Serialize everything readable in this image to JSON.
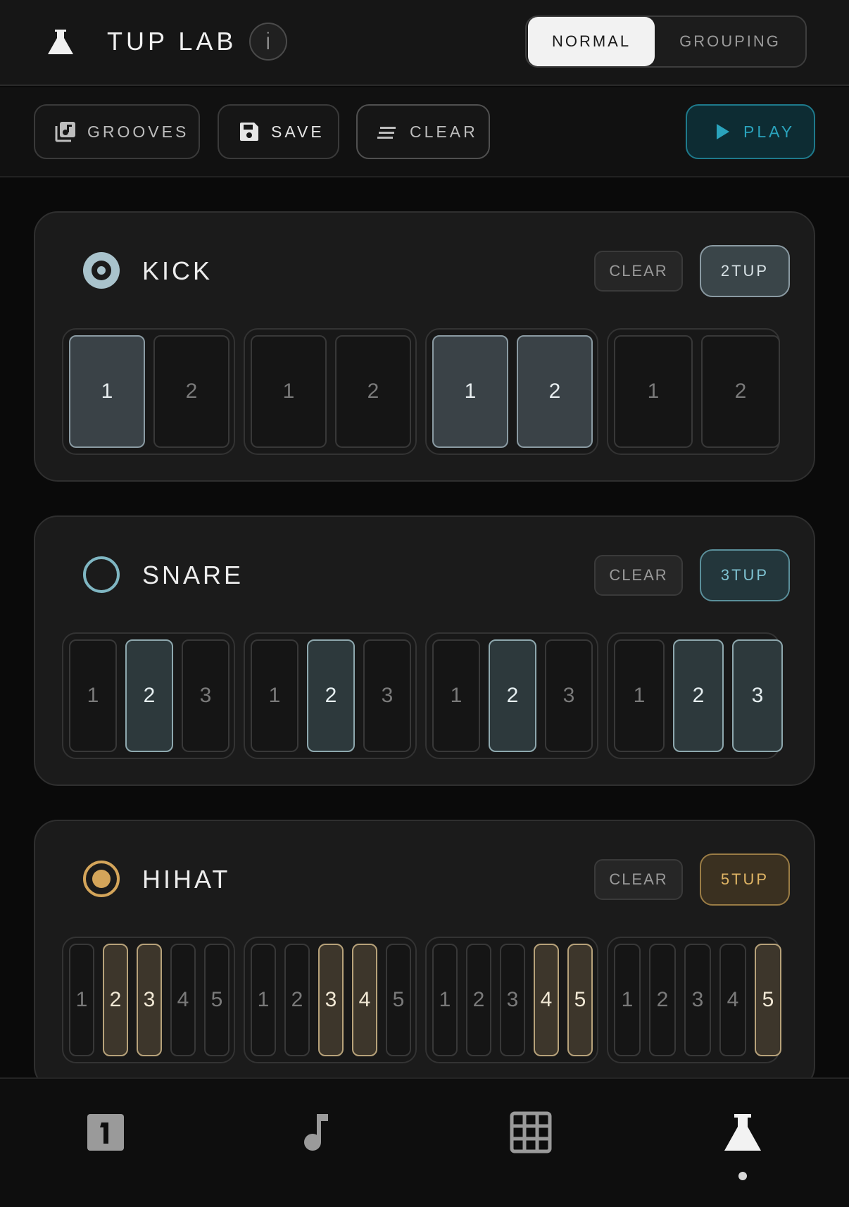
{
  "header": {
    "title": "TUP LAB",
    "info_label": "i",
    "modes": [
      {
        "label": "NORMAL",
        "active": true
      },
      {
        "label": "GROUPING",
        "active": false
      }
    ]
  },
  "toolbar": {
    "grooves_label": "GROOVES",
    "save_label": "SAVE",
    "clear_label": "CLEAR",
    "play_label": "PLAY"
  },
  "colors": {
    "accent_teal": "#2aa3bc",
    "kick": "#a9c3cc",
    "snare": "#7fb6c2",
    "hihat": "#d4a55a"
  },
  "tracks": [
    {
      "name": "KICK",
      "clear_label": "CLEAR",
      "tup_label": "2TUP",
      "icon": "target-dot-icon",
      "groups": [
        [
          {
            "label": "1",
            "on": true
          },
          {
            "label": "2",
            "on": false
          }
        ],
        [
          {
            "label": "1",
            "on": false
          },
          {
            "label": "2",
            "on": false
          }
        ],
        [
          {
            "label": "1",
            "on": true
          },
          {
            "label": "2",
            "on": true
          }
        ],
        [
          {
            "label": "1",
            "on": false
          },
          {
            "label": "2",
            "on": false
          }
        ]
      ]
    },
    {
      "name": "SNARE",
      "clear_label": "CLEAR",
      "tup_label": "3TUP",
      "icon": "ring-icon",
      "groups": [
        [
          {
            "label": "1",
            "on": false
          },
          {
            "label": "2",
            "on": true
          },
          {
            "label": "3",
            "on": false
          }
        ],
        [
          {
            "label": "1",
            "on": false
          },
          {
            "label": "2",
            "on": true
          },
          {
            "label": "3",
            "on": false
          }
        ],
        [
          {
            "label": "1",
            "on": false
          },
          {
            "label": "2",
            "on": true
          },
          {
            "label": "3",
            "on": false
          }
        ],
        [
          {
            "label": "1",
            "on": false
          },
          {
            "label": "2",
            "on": true
          },
          {
            "label": "3",
            "on": true
          }
        ]
      ]
    },
    {
      "name": "HIHAT",
      "clear_label": "CLEAR",
      "tup_label": "5TUP",
      "icon": "filled-ring-icon",
      "groups": [
        [
          {
            "label": "1",
            "on": false
          },
          {
            "label": "2",
            "on": true
          },
          {
            "label": "3",
            "on": true
          },
          {
            "label": "4",
            "on": false
          },
          {
            "label": "5",
            "on": false
          }
        ],
        [
          {
            "label": "1",
            "on": false
          },
          {
            "label": "2",
            "on": false
          },
          {
            "label": "3",
            "on": true
          },
          {
            "label": "4",
            "on": true
          },
          {
            "label": "5",
            "on": false
          }
        ],
        [
          {
            "label": "1",
            "on": false
          },
          {
            "label": "2",
            "on": false
          },
          {
            "label": "3",
            "on": false
          },
          {
            "label": "4",
            "on": true
          },
          {
            "label": "5",
            "on": true
          }
        ],
        [
          {
            "label": "1",
            "on": false
          },
          {
            "label": "2",
            "on": false
          },
          {
            "label": "3",
            "on": false
          },
          {
            "label": "4",
            "on": false
          },
          {
            "label": "5",
            "on": true
          }
        ]
      ]
    }
  ],
  "bottom_nav": {
    "items": [
      {
        "icon": "one-box-icon",
        "active": false
      },
      {
        "icon": "music-note-icon",
        "active": false
      },
      {
        "icon": "grid-icon",
        "active": false
      },
      {
        "icon": "flask-icon",
        "active": true
      }
    ]
  }
}
